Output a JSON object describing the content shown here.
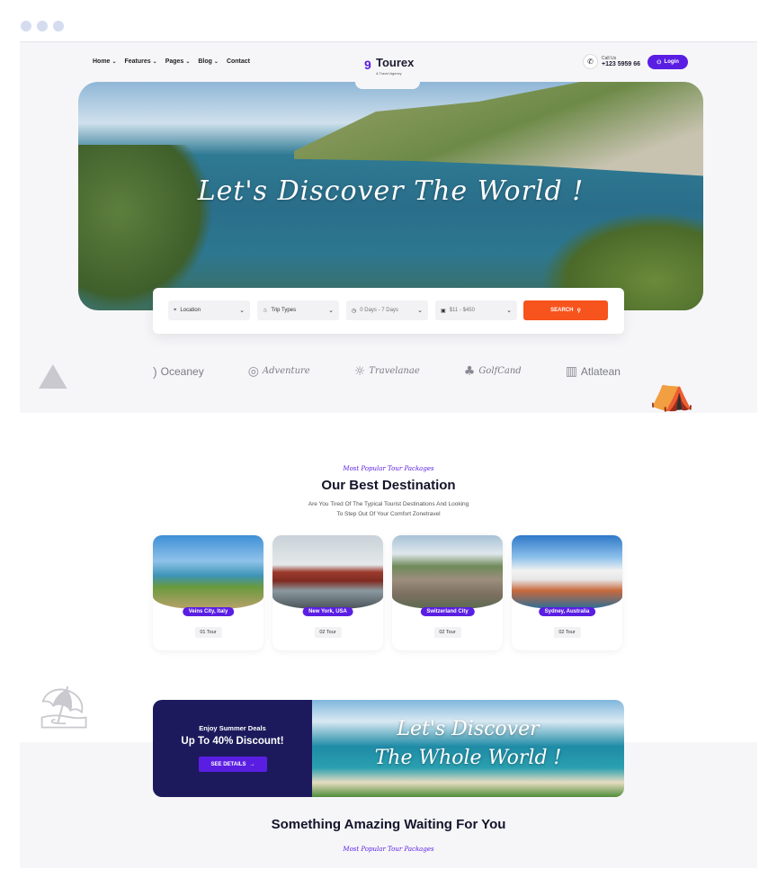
{
  "nav": {
    "items": [
      "Home",
      "Features",
      "Pages",
      "Blog",
      "Contact"
    ],
    "logo": "Tourex",
    "logo_sub": "A Travel Agency",
    "call_label": "Call Us",
    "call_number": "+123 5959 66",
    "login": "Login"
  },
  "hero": {
    "title": "Let's Discover The World !"
  },
  "search": {
    "location": "Location",
    "trip_types": "Trip Types",
    "days": "0 Days - 7 Days",
    "price": "$11 - $450",
    "button": "SEARCH"
  },
  "brands": [
    "Oceaney",
    "Adventure",
    "Travelanae",
    "GolfCand",
    "Atlatean"
  ],
  "destinations": {
    "kicker": "Most Popular Tour Packages",
    "title": "Our Best Destination",
    "subtitle_line1": "Are You Tired Of The Typical Tourist Destinations And Looking",
    "subtitle_line2": "To Step Out Of Your Comfort Zonetravel",
    "cards": [
      {
        "name": "Veins City, Italy",
        "tours": "01 Tour"
      },
      {
        "name": "New York, USA",
        "tours": "02 Tour"
      },
      {
        "name": "Switzerland City",
        "tours": "02 Tour"
      },
      {
        "name": "Sydney, Australia",
        "tours": "02 Tour"
      }
    ]
  },
  "deal": {
    "small": "Enjoy Summer Deals",
    "big": "Up To 40% Discount!",
    "button": "SEE DETAILS",
    "script_line1": "Let's Discover",
    "script_line2": "The Whole World !"
  },
  "next_section": {
    "kicker": "Most Popular Tour Packages",
    "title": "Something Amazing Waiting For You"
  }
}
